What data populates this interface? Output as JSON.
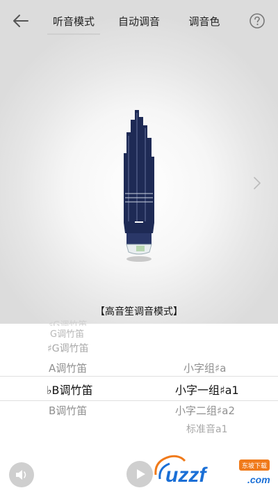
{
  "header": {
    "tabs": [
      {
        "label": "听音模式",
        "active": true
      },
      {
        "label": "自动调音",
        "active": false
      },
      {
        "label": "调音色",
        "active": false
      }
    ]
  },
  "stage": {
    "mode_title": "【高音笙调音模式】"
  },
  "picker": {
    "left_column": [
      "♯G调竹笛",
      "G调竹笛",
      "♯G调竹笛",
      "A调竹笛",
      "♭B调竹笛",
      "B调竹笛"
    ],
    "left_selected": "♭B调竹笛",
    "right_column": [
      "小字组♯a",
      "小字一组♯a1",
      "小字二组♯a2",
      "标准音a1"
    ],
    "right_selected": "小字一组♯a1"
  },
  "watermark": {
    "text": "uzzf",
    "suffix": ".com",
    "badge": "东坡下载"
  },
  "colors": {
    "instrument": "#1e2a55",
    "selected_text": "#111111",
    "muted_text": "#888888",
    "watermark_blue": "#1a6fd6",
    "watermark_orange": "#f07a1a"
  }
}
